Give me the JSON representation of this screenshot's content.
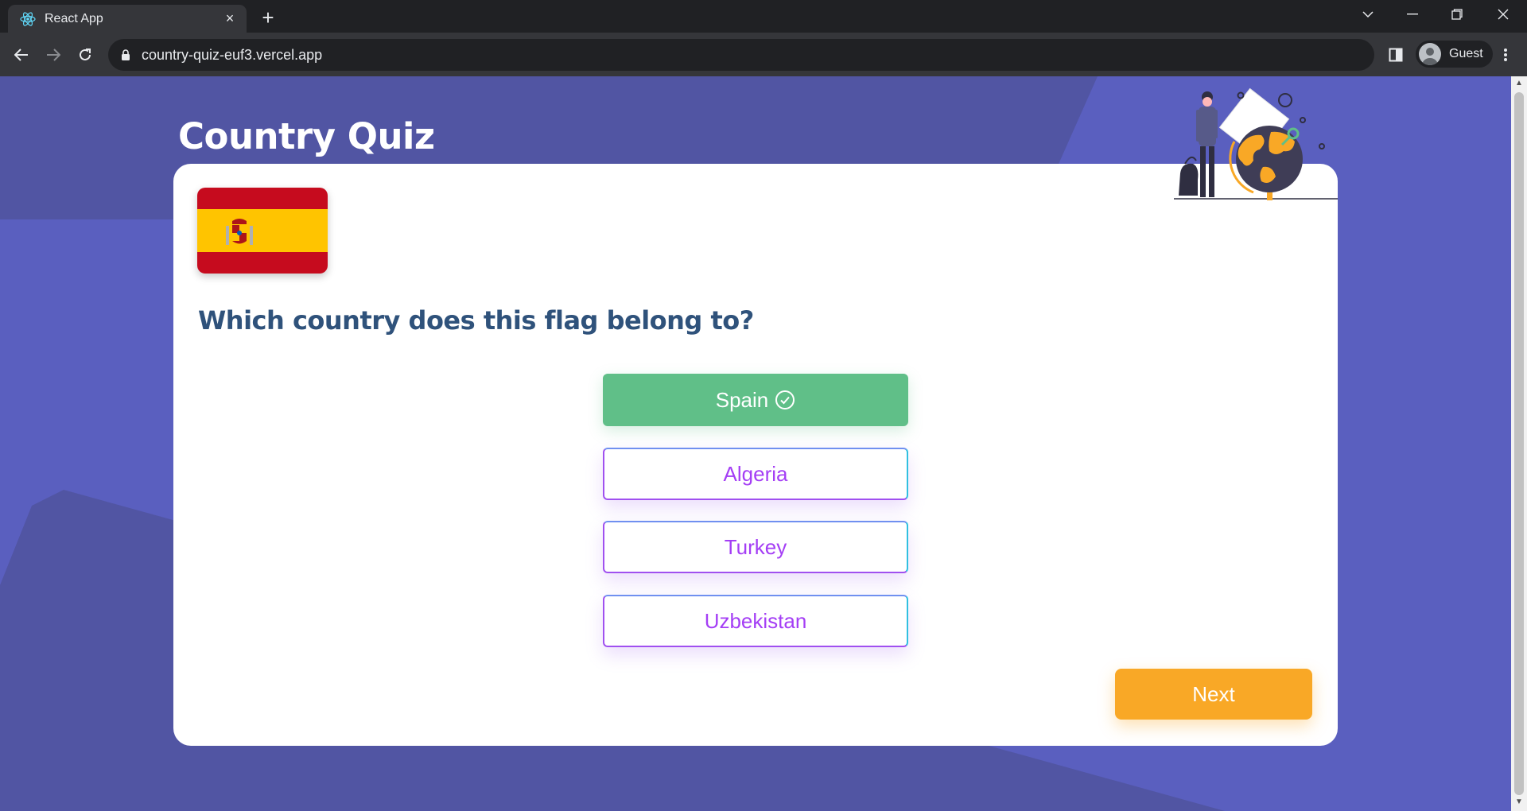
{
  "browser": {
    "tab_title": "React App",
    "tab_close": "×",
    "new_tab": "+",
    "url": "country-quiz-euf3.vercel.app",
    "profile_label": "Guest"
  },
  "page": {
    "title": "Country Quiz",
    "flag_icon": "spain-flag",
    "question": "Which country does this flag belong to?",
    "options": [
      {
        "label": "Spain",
        "state": "correct",
        "icon": "check-circle-icon"
      },
      {
        "label": "Algeria",
        "state": "default"
      },
      {
        "label": "Turkey",
        "state": "default"
      },
      {
        "label": "Uzbekistan",
        "state": "default"
      }
    ],
    "next_label": "Next"
  },
  "colors": {
    "background": "#5a5fbf",
    "title": "#ffffff",
    "question": "#2f527b",
    "correct": "#60bf88",
    "option_text": "#a43ef5",
    "next": "#f9a826"
  }
}
